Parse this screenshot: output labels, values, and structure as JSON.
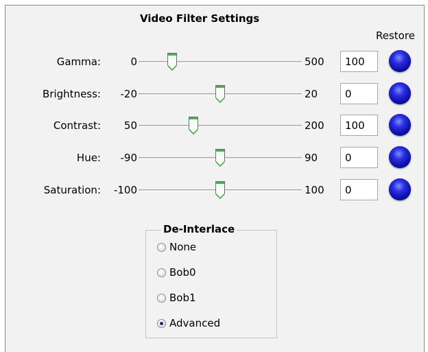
{
  "title": "Video Filter Settings",
  "restore_header": "Restore",
  "sliders": [
    {
      "label": "Gamma:",
      "min": "0",
      "max": "500",
      "value": "100",
      "fraction": 0.2
    },
    {
      "label": "Brightness:",
      "min": "-20",
      "max": "20",
      "value": "0",
      "fraction": 0.5
    },
    {
      "label": "Contrast:",
      "min": "50",
      "max": "200",
      "value": "100",
      "fraction": 0.333
    },
    {
      "label": "Hue:",
      "min": "-90",
      "max": "90",
      "value": "0",
      "fraction": 0.5
    },
    {
      "label": "Saturation:",
      "min": "-100",
      "max": "100",
      "value": "0",
      "fraction": 0.5
    }
  ],
  "deinterlace": {
    "title": "De-Interlace",
    "options": [
      "None",
      "Bob0",
      "Bob1",
      "Advanced"
    ],
    "selected": "Advanced"
  },
  "colors": {
    "panel_bg": "#f2f2f2",
    "restore_button": "#1a1fd0",
    "thumb_accent": "#3cb84a"
  }
}
